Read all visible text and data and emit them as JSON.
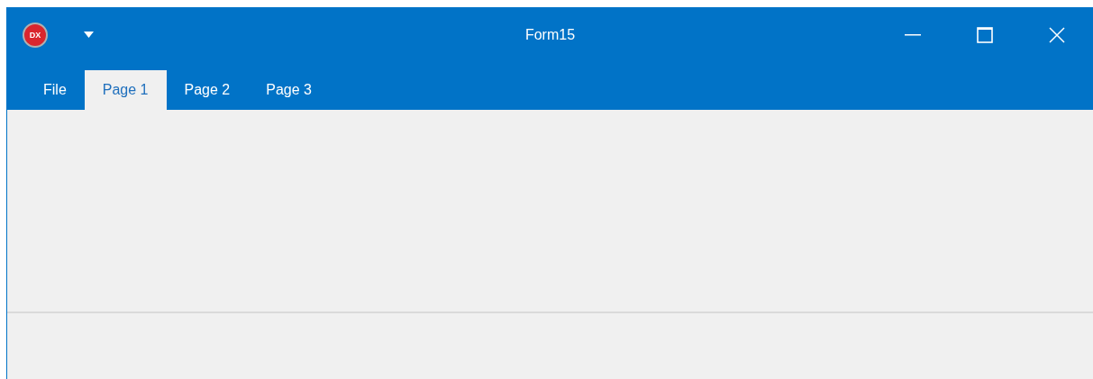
{
  "window": {
    "title": "Form15",
    "logo": "DX"
  },
  "tabs": [
    {
      "label": "File",
      "selected": false
    },
    {
      "label": "Page 1",
      "selected": true
    },
    {
      "label": "Page 2",
      "selected": false
    },
    {
      "label": "Page 3",
      "selected": false
    }
  ]
}
